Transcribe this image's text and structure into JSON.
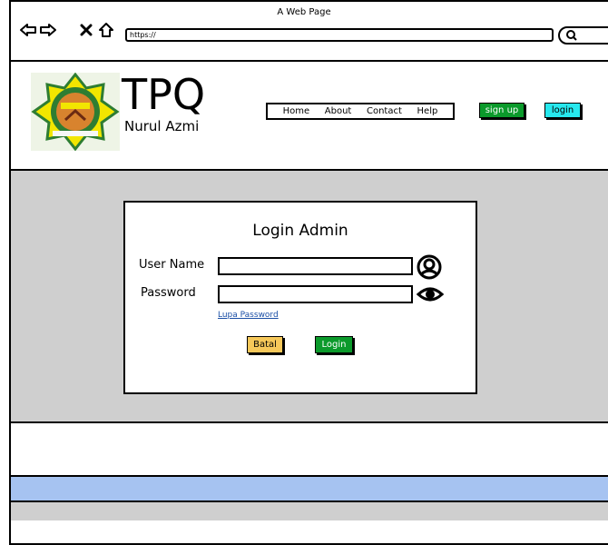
{
  "browser": {
    "window_title": "A Web Page",
    "url": "https://",
    "icons": [
      "back-icon",
      "forward-icon",
      "close-icon",
      "home-icon",
      "search-icon"
    ]
  },
  "header": {
    "brand_title": "TPQ",
    "brand_subtitle": "Nurul Azmi",
    "nav": [
      "Home",
      "About",
      "Contact",
      "Help"
    ],
    "signup_label": "sign up",
    "login_label": "login"
  },
  "login_form": {
    "title": "Login Admin",
    "username_label": "User Name",
    "password_label": "Password",
    "username_value": "",
    "password_value": "",
    "forgot_label": "Lupa Password",
    "cancel_label": "Batal",
    "submit_label": "Login"
  },
  "colors": {
    "green": "#0b9a2b",
    "cyan": "#27e8ee",
    "yellow": "#f6c85a",
    "gray": "#cfcfcf",
    "blue": "#a6c3f1"
  }
}
